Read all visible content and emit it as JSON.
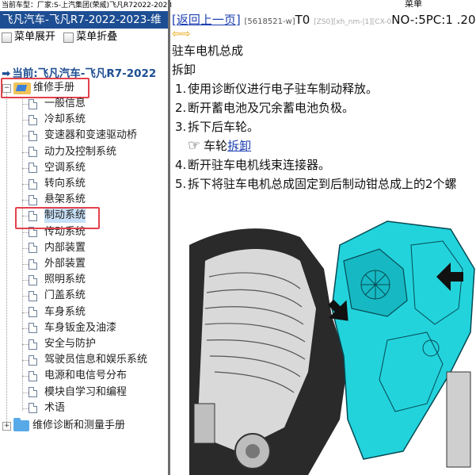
{
  "topline": {
    "label": "当前车型：厂家:S-上汽集团(荣威)飞凡R72022-2023",
    "right_menu": "菜单"
  },
  "left_panel": {
    "title": "飞凡汽车-飞凡R7-2022-2023-维",
    "toolbar": {
      "expand": "菜单展开",
      "collapse": "菜单折叠"
    },
    "current": "当前:飞凡汽车-飞凡R7-2022",
    "root": "维修手册",
    "items": [
      "一般信息",
      "冷却系统",
      "变速器和变速驱动桥",
      "动力及控制系统",
      "空调系统",
      "转向系统",
      "悬架系统",
      "制动系统",
      "传动系统",
      "内部装置",
      "外部装置",
      "照明系统",
      "门盖系统",
      "车身系统",
      "车身钣金及油漆",
      "安全与防护",
      "驾驶员信息和娱乐系统",
      "电源和电信号分布",
      "模块自学习和编程",
      "术语"
    ],
    "second_root": "维修诊断和测量手册",
    "colors": {
      "title_bg": "#1d4e93",
      "highlight": "#e2414d"
    }
  },
  "right_panel": {
    "back_link": "[返回上一页]",
    "doc_id": "[5618521-w]",
    "code": "T0",
    "grey_id": "[ZS0][xh_nm-|1][CX-0",
    "no_label": "NO-:5PC:1 .20",
    "heading": "驻车电机总成",
    "sub_heading": "拆卸",
    "steps": [
      "使用诊断仪进行电子驻车制动释放。",
      "断开蓄电池及冗余蓄电池负极。",
      "拆下后车轮。",
      "断开驻车电机线束连接器。",
      "拆下将驻车电机总成固定到后制动钳总成上的2个螺"
    ],
    "step_numbers": [
      "1.",
      "2.",
      "3.",
      "4.",
      "5."
    ],
    "ref_text": "车轮",
    "ref_link": "拆卸"
  }
}
